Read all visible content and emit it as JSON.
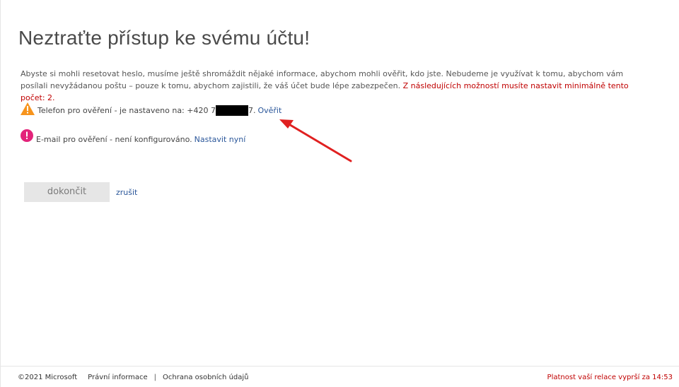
{
  "page": {
    "title": "Neztraťte přístup ke svému účtu!",
    "intro_text": "Abyste si mohli resetovat heslo, musíme ještě shromáždit nějaké informace, abychom mohli ověřit, kdo jste. Nebudeme je využívat k tomu, abychom vám posílali nevyžádanou poštu – pouze k tomu, abychom zajistili, že váš účet bude lépe zabezpečen. ",
    "intro_required": "Z následujících možností musíte nastavit minimálně tento počet: 2."
  },
  "methods": {
    "phone": {
      "icon": "warning-icon",
      "label_prefix": "Telefon pro ověření - je nastaveno na: +420 7",
      "label_suffix": "7.",
      "action": "Ověřit"
    },
    "email": {
      "icon": "error-icon",
      "label": "E-mail pro ověření - není konfigurováno.",
      "action": "Nastavit nyní"
    }
  },
  "actions": {
    "finish_label": "dokončit",
    "cancel_label": "zrušit"
  },
  "footer": {
    "copyright": "©2021 Microsoft",
    "legal": "Právní informace",
    "separator": "|",
    "privacy": "Ochrana osobních údajů",
    "session": "Platnost vaší relace vyprší za 14:53"
  },
  "colors": {
    "link": "#2b579a",
    "required": "#c00000",
    "warning": "#f7941d",
    "error": "#e3237a",
    "annotation_arrow": "#e02020"
  }
}
